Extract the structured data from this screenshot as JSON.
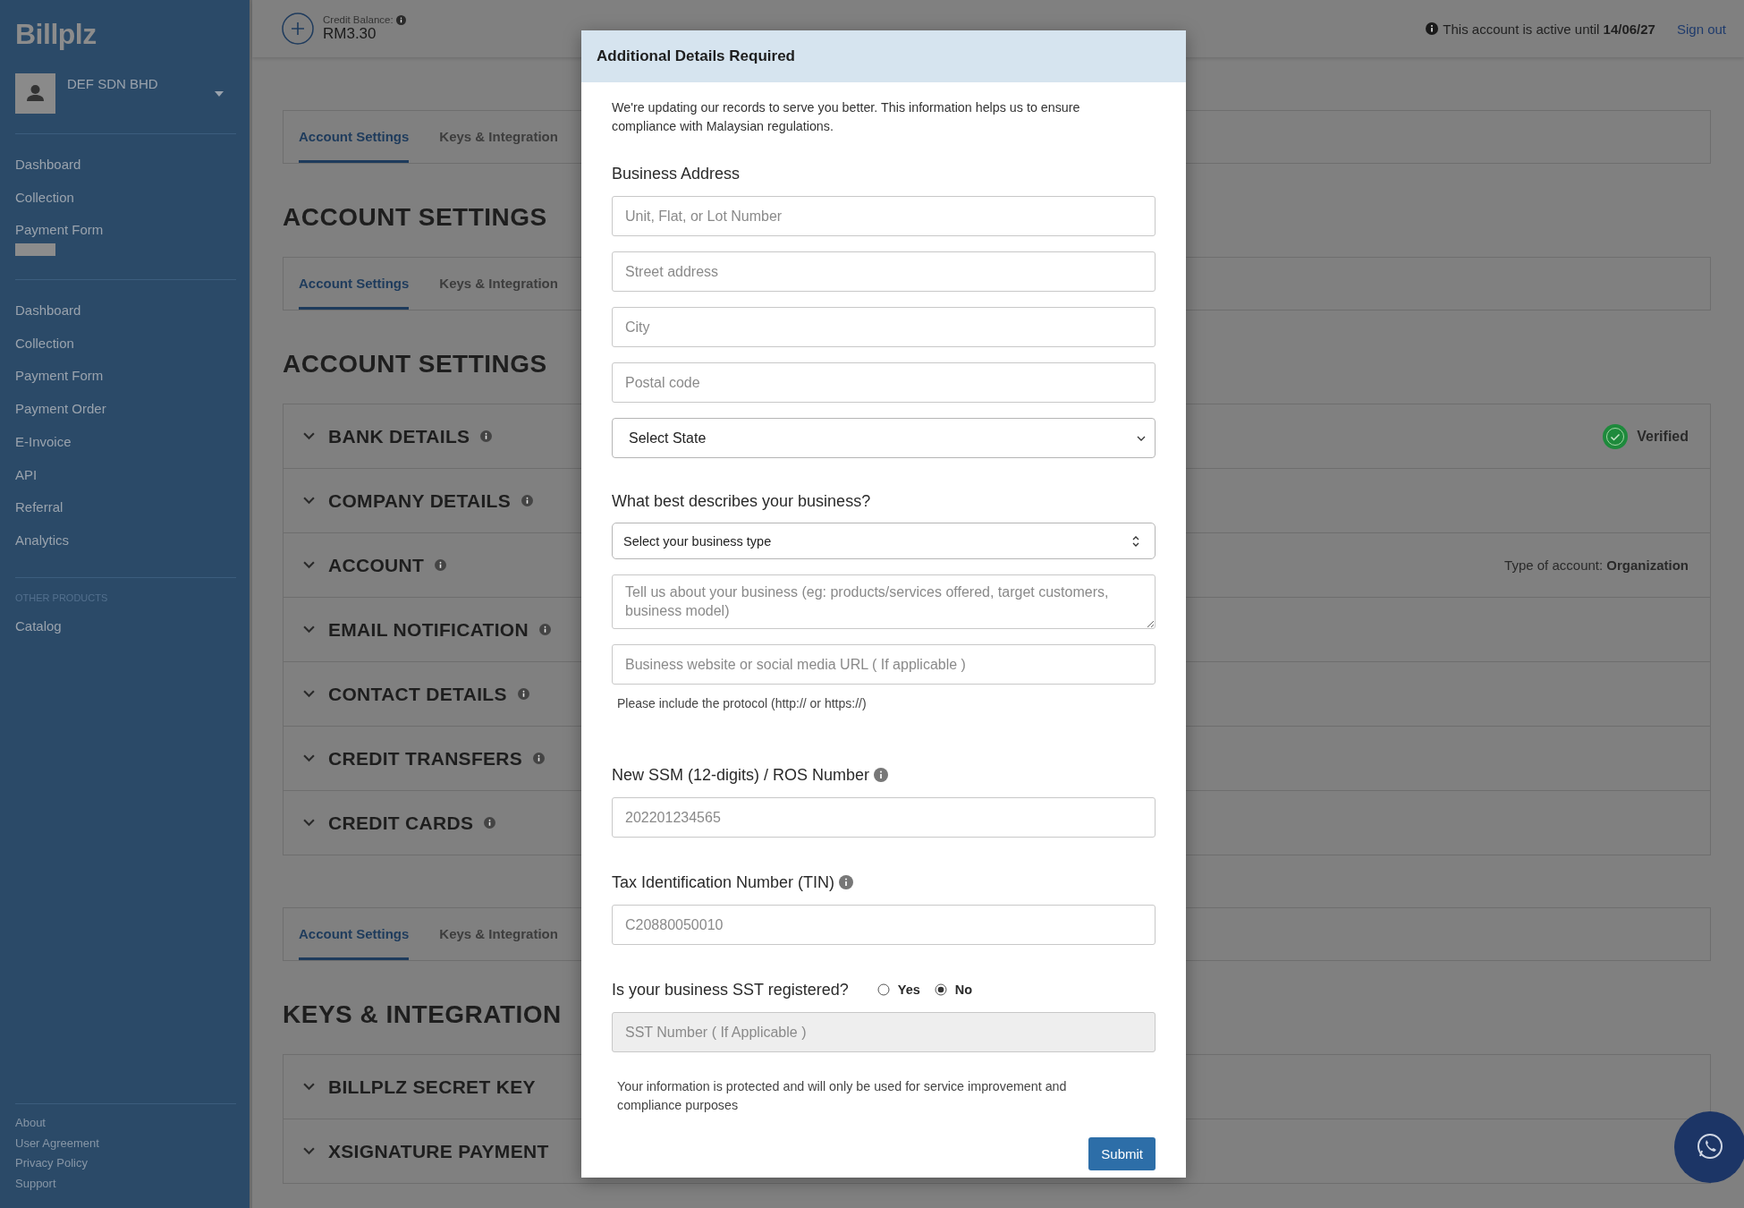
{
  "sidebar": {
    "logo": "Billplz",
    "account": "DEF SDN BHD",
    "menu_primary": [
      "Dashboard",
      "Collection",
      "Payment Form"
    ],
    "menu_secondary": [
      "Dashboard",
      "Collection",
      "Payment Form",
      "Payment Order",
      "E-Invoice",
      "API",
      "Referral",
      "Analytics"
    ],
    "other_products_label": "OTHER PRODUCTS",
    "other_products": [
      "Catalog"
    ],
    "footer_links": [
      "About",
      "User Agreement",
      "Privacy Policy",
      "Support"
    ]
  },
  "topbar": {
    "credit_label": "Credit Balance:",
    "credit_value": "RM3.30",
    "active_text": "This account is active until **14/06/27**",
    "sign_out": "Sign out"
  },
  "sections": [
    {
      "tabs": [
        {
          "label": "Account Settings",
          "selected": true
        },
        {
          "label": "Keys & Integration",
          "selected": false
        }
      ],
      "heading": "ACCOUNT SETTINGS"
    },
    {
      "tabs": [
        {
          "label": "Account Settings",
          "selected": true
        },
        {
          "label": "Keys & Integration",
          "selected": false
        }
      ],
      "heading": "ACCOUNT SETTINGS",
      "rows": [
        {
          "title": "BANK DETAILS",
          "info": true,
          "status": "Verified"
        },
        {
          "title": "COMPANY DETAILS",
          "info": true
        },
        {
          "title": "ACCOUNT",
          "info": true,
          "aside": "Type of account: **Organization**"
        },
        {
          "title": "EMAIL NOTIFICATION",
          "info": true
        },
        {
          "title": "CONTACT DETAILS",
          "info": true
        },
        {
          "title": "CREDIT TRANSFERS",
          "info": true
        },
        {
          "title": "CREDIT CARDS",
          "info": true
        }
      ]
    },
    {
      "tabs": [
        {
          "label": "Account Settings",
          "selected": true
        },
        {
          "label": "Keys & Integration",
          "selected": false
        }
      ],
      "heading": "KEYS & INTEGRATION",
      "rows": [
        {
          "title": "BILLPLZ SECRET KEY",
          "info": false
        },
        {
          "title": "XSIGNATURE PAYMENT",
          "info": false
        }
      ]
    }
  ],
  "modal": {
    "title": "Additional Details Required",
    "intro": "We're updating our records to serve you better. This information helps us to ensure compliance with Malaysian regulations.",
    "address_heading": "Business Address",
    "address_fields": [
      {
        "placeholder": "Unit, Flat, or Lot Number"
      },
      {
        "placeholder": "Street address"
      },
      {
        "placeholder": "City"
      },
      {
        "placeholder": "Postal code"
      }
    ],
    "state_select": "Select State",
    "business_heading": "What best describes your business?",
    "business_type_select": "Select your business type",
    "description_placeholder": "Tell us about your business (eg: products/services offered, target customers, business model)",
    "website_placeholder": "Business website or social media URL ( If applicable )",
    "website_hint": "Please include the protocol (http:// or https://)",
    "ssm_label": "New SSM (12-digits) / ROS Number",
    "ssm_placeholder": "202201234565",
    "tin_label": "Tax Identification Number (TIN)",
    "tin_placeholder": "C20880050010",
    "sst_question": "Is your business SST registered?",
    "sst_options": [
      {
        "label": "Yes",
        "selected": false
      },
      {
        "label": "No",
        "selected": true
      }
    ],
    "sst_number_placeholder": "SST Number ( If Applicable )",
    "sst_number_disabled": true,
    "privacy_note": "Your information is protected and will only be used for service improvement and compliance purposes",
    "submit": "Submit"
  }
}
